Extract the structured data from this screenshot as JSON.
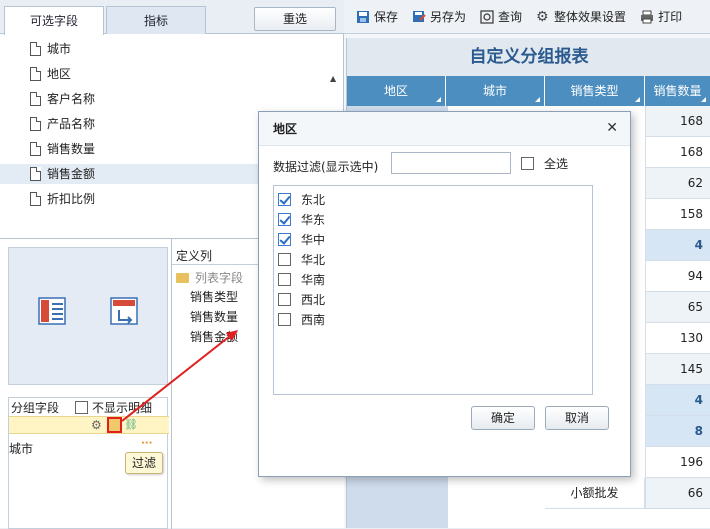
{
  "tabs": [
    "可选字段",
    "指标"
  ],
  "reset_label": "重选",
  "fields": [
    "城市",
    "地区",
    "客户名称",
    "产品名称",
    "销售数量",
    "销售金额",
    "折扣比例"
  ],
  "group": {
    "label": "分组字段",
    "hide_detail": "不显示明细",
    "item": "城市",
    "tooltip": "过滤"
  },
  "define": {
    "head": "定义列",
    "folder": "列表字段",
    "items": [
      "销售类型",
      "销售数量",
      "销售金额"
    ]
  },
  "toolbar": [
    "保存",
    "另存为",
    "查询",
    "整体效果设置",
    "打印"
  ],
  "report": {
    "title": "自定义分组报表",
    "headers": [
      "地区",
      "城市",
      "销售类型",
      "销售数量"
    ],
    "values": [
      "168",
      "168",
      "62",
      "158",
      "4",
      "94",
      "65",
      "130",
      "145",
      "4",
      "8",
      "196",
      "66"
    ],
    "type_labels": [
      "小额批发"
    ]
  },
  "dialog": {
    "title": "地区",
    "filter_label": "数据过滤(显示选中)",
    "filter_value": "",
    "select_all": "全选",
    "options": [
      {
        "label": "东北",
        "checked": true
      },
      {
        "label": "华东",
        "checked": true
      },
      {
        "label": "华中",
        "checked": true
      },
      {
        "label": "华北",
        "checked": false
      },
      {
        "label": "华南",
        "checked": false
      },
      {
        "label": "西北",
        "checked": false
      },
      {
        "label": "西南",
        "checked": false
      }
    ],
    "ok": "确定",
    "cancel": "取消"
  }
}
